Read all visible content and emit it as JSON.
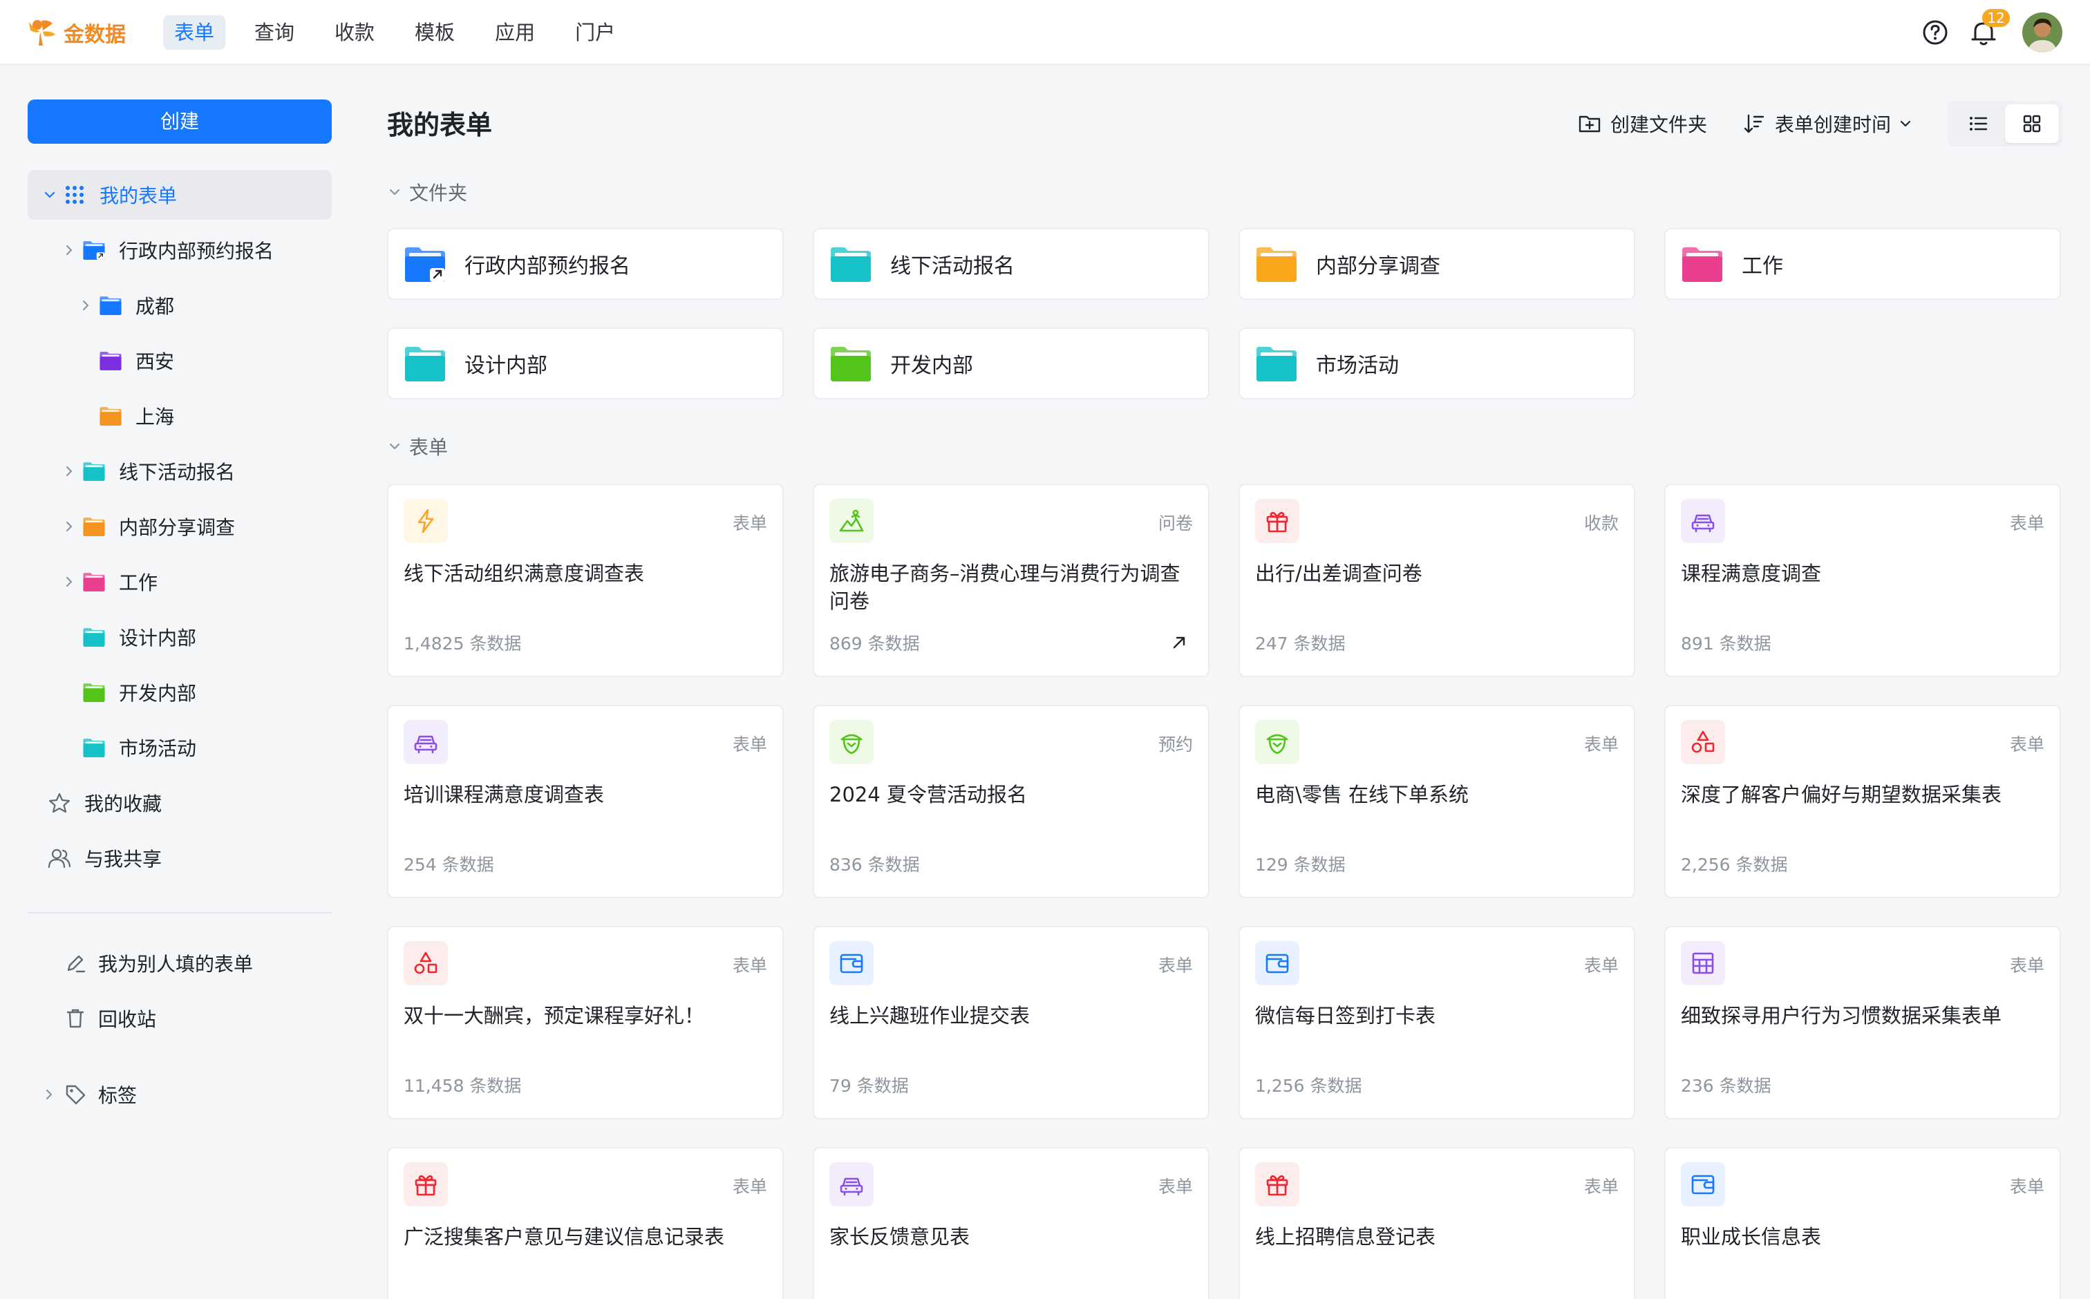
{
  "app": {
    "name": "金数据",
    "accent": "#1677ff",
    "brand_color": "#f08a24"
  },
  "nav": [
    {
      "label": "表单",
      "active": true
    },
    {
      "label": "查询",
      "active": false
    },
    {
      "label": "收款",
      "active": false
    },
    {
      "label": "模板",
      "active": false
    },
    {
      "label": "应用",
      "active": false
    },
    {
      "label": "门户",
      "active": false
    }
  ],
  "header": {
    "notification_count": "12",
    "help_icon": "help-circle-icon",
    "bell_icon": "bell-icon"
  },
  "sidebar": {
    "create_label": "创建",
    "tree": [
      {
        "label": "我的表单",
        "icon": "grid-dots-icon",
        "expanded": true,
        "selected": true,
        "depth": 0
      },
      {
        "label": "行政内部预约报名",
        "icon": "folder-shared-icon",
        "color": "#1677ff",
        "depth": 1,
        "has_children": true
      },
      {
        "label": "成都",
        "icon": "folder-icon",
        "color": "#1677ff",
        "depth": 2,
        "has_children": true
      },
      {
        "label": "西安",
        "icon": "folder-icon",
        "color": "#7b2fe0",
        "depth": 2
      },
      {
        "label": "上海",
        "icon": "folder-icon",
        "color": "#f5941f",
        "depth": 2
      },
      {
        "label": "线下活动报名",
        "icon": "folder-icon",
        "color": "#14c2c7",
        "depth": 1,
        "has_children": true
      },
      {
        "label": "内部分享调查",
        "icon": "folder-icon",
        "color": "#f5941f",
        "depth": 1,
        "has_children": true
      },
      {
        "label": "工作",
        "icon": "folder-icon",
        "color": "#ea3e8f",
        "depth": 1,
        "has_children": true
      },
      {
        "label": "设计内部",
        "icon": "folder-icon",
        "color": "#14c2c7",
        "depth": 1
      },
      {
        "label": "开发内部",
        "icon": "folder-icon",
        "color": "#52c41a",
        "depth": 1
      },
      {
        "label": "市场活动",
        "icon": "folder-icon",
        "color": "#14c2c7",
        "depth": 1
      },
      {
        "label": "我的收藏",
        "icon": "star-icon",
        "depth": 0
      },
      {
        "label": "与我共享",
        "icon": "users-icon",
        "depth": 0
      }
    ],
    "links": [
      {
        "label": "我为别人填的表单",
        "icon": "pen-icon"
      },
      {
        "label": "回收站",
        "icon": "trash-icon"
      }
    ],
    "tags_label": "标签"
  },
  "main": {
    "title": "我的表单",
    "create_folder_label": "创建文件夹",
    "sort_label": "表单创建时间",
    "folders_section": "文件夹",
    "forms_section": "表单",
    "folders": [
      {
        "label": "行政内部预约报名",
        "color": "#1677ff",
        "shared": true
      },
      {
        "label": "线下活动报名",
        "color": "#14c2c7"
      },
      {
        "label": "内部分享调查",
        "color": "#f9a61a"
      },
      {
        "label": "工作",
        "color": "#ea3e8f"
      },
      {
        "label": "设计内部",
        "color": "#14c2c7"
      },
      {
        "label": "开发内部",
        "color": "#52c41a"
      },
      {
        "label": "市场活动",
        "color": "#14c2c7"
      }
    ],
    "forms": [
      {
        "name": "线下活动组织满意度调查表",
        "type": "表单",
        "count": "1,4825 条数据",
        "icon": "lightning-icon",
        "color": "#f5a623",
        "bg": "#fff6e6"
      },
      {
        "name": "旅游电子商务–消费心理与消费行为调查问卷",
        "type": "问卷",
        "count": "869 条数据",
        "icon": "landscape-icon",
        "color": "#52c41a",
        "bg": "#eefae6",
        "external": true
      },
      {
        "name": "出行/出差调查问卷",
        "type": "收款",
        "count": "247 条数据",
        "icon": "gift-icon",
        "color": "#f5222d",
        "bg": "#fdecec"
      },
      {
        "name": "课程满意度调查",
        "type": "表单",
        "count": "891 条数据",
        "icon": "car-icon",
        "color": "#8a4ee8",
        "bg": "#f3ecfd"
      },
      {
        "name": "培训课程满意度调查表",
        "type": "表单",
        "count": "254 条数据",
        "icon": "car-icon",
        "color": "#8a4ee8",
        "bg": "#f3ecfd"
      },
      {
        "name": "2024 夏令营活动报名",
        "type": "预约",
        "count": "836 条数据",
        "icon": "acorn-icon",
        "color": "#52c41a",
        "bg": "#eefae6"
      },
      {
        "name": "电商\\零售 在线下单系统",
        "type": "表单",
        "count": "129 条数据",
        "icon": "acorn-icon",
        "color": "#52c41a",
        "bg": "#eefae6"
      },
      {
        "name": "深度了解客户偏好与期望数据采集表",
        "type": "表单",
        "count": "2,256 条数据",
        "icon": "shapes-icon",
        "color": "#f5222d",
        "bg": "#fdecec"
      },
      {
        "name": "双十一大酬宾，预定课程享好礼！",
        "type": "表单",
        "count": "11,458 条数据",
        "icon": "shapes-icon",
        "color": "#f5222d",
        "bg": "#fdecec"
      },
      {
        "name": "线上兴趣班作业提交表",
        "type": "表单",
        "count": "79 条数据",
        "icon": "wallet-icon",
        "color": "#1677ff",
        "bg": "#e8f1ff"
      },
      {
        "name": "微信每日签到打卡表",
        "type": "表单",
        "count": "1,256 条数据",
        "icon": "wallet-icon",
        "color": "#1677ff",
        "bg": "#e8f1ff"
      },
      {
        "name": "细致探寻用户行为习惯数据采集表单",
        "type": "表单",
        "count": "236 条数据",
        "icon": "table-icon",
        "color": "#8a4ee8",
        "bg": "#f3ecfd"
      },
      {
        "name": "广泛搜集客户意见与建议信息记录表",
        "type": "表单",
        "count": "",
        "icon": "gift-icon",
        "color": "#f5222d",
        "bg": "#fdecec"
      },
      {
        "name": "家长反馈意见表",
        "type": "表单",
        "count": "",
        "icon": "car-icon",
        "color": "#8a4ee8",
        "bg": "#f3ecfd"
      },
      {
        "name": "线上招聘信息登记表",
        "type": "表单",
        "count": "",
        "icon": "gift-icon",
        "color": "#f5222d",
        "bg": "#fdecec"
      },
      {
        "name": "职业成长信息表",
        "type": "表单",
        "count": "",
        "icon": "wallet-icon",
        "color": "#1677ff",
        "bg": "#e8f1ff"
      }
    ]
  }
}
